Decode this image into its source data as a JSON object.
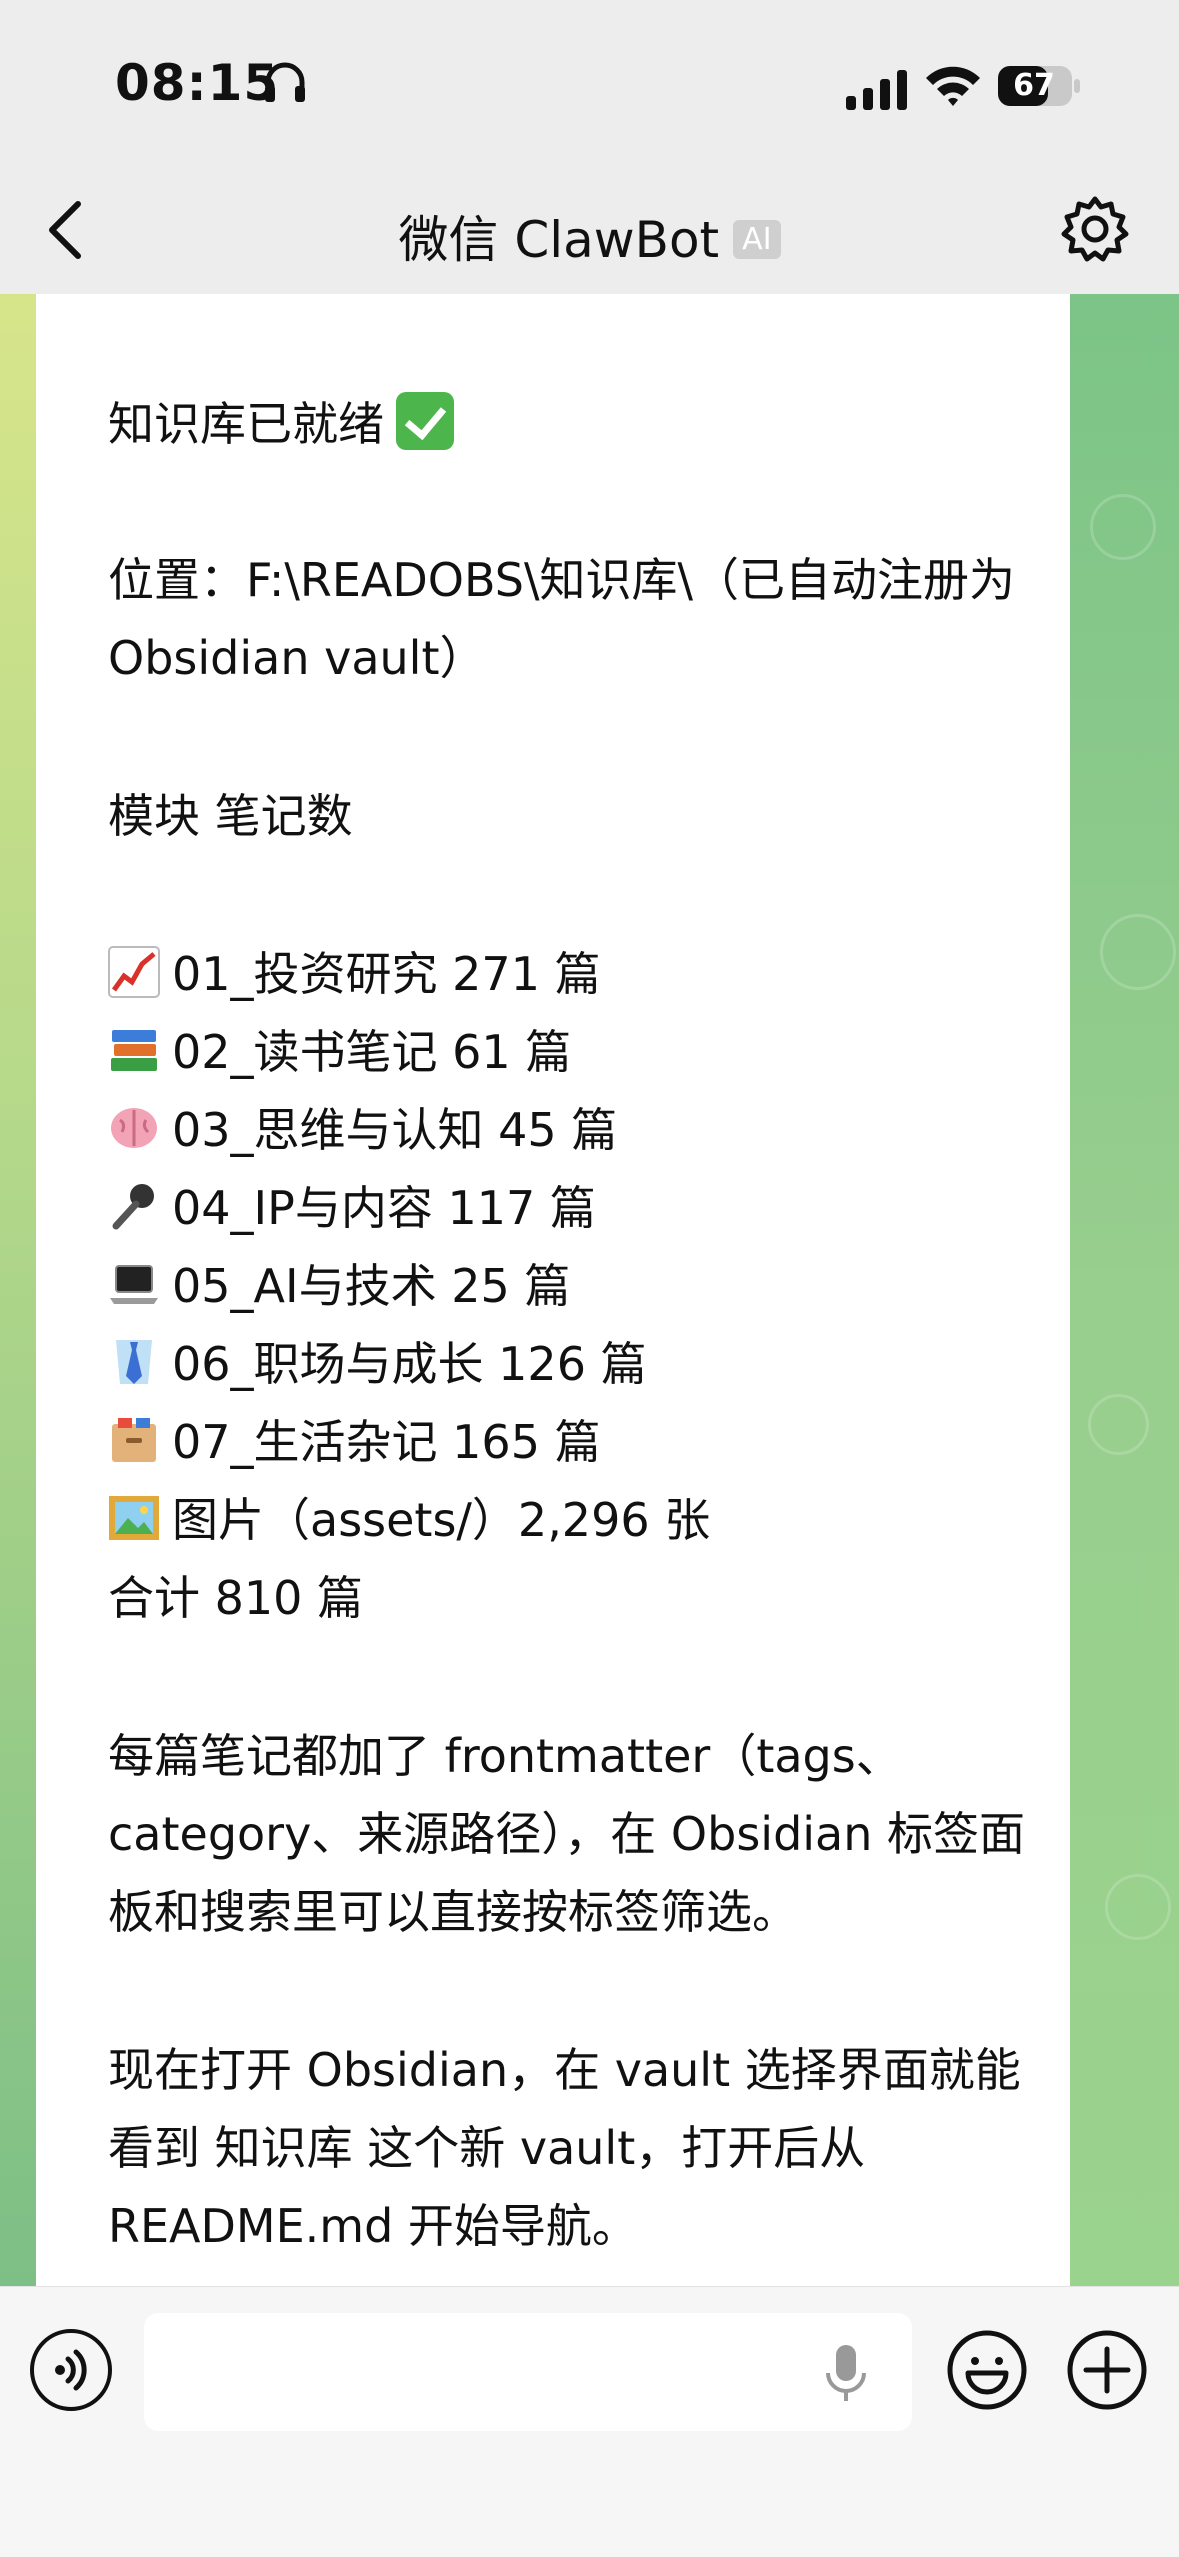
{
  "status_bar": {
    "time": "08:15",
    "battery": "67",
    "icons": [
      "headphone-icon",
      "signal-icon",
      "wifi-icon",
      "battery-icon"
    ]
  },
  "nav": {
    "title": "微信 ClawBot",
    "badge": "AI",
    "icons": [
      "back-icon",
      "gear-icon"
    ]
  },
  "message": {
    "status_line": "知识库已就绪",
    "location_line1": "位置：F:\\READOBS\\知识库\\（已自动注册为",
    "location_line2": "Obsidian vault）",
    "table_header": "模块  笔记数",
    "modules": [
      {
        "emoji": "chart-increasing-icon",
        "text": "01_投资研究  271 篇"
      },
      {
        "emoji": "books-icon",
        "text": "02_读书笔记  61 篇"
      },
      {
        "emoji": "brain-icon",
        "text": "03_思维与认知  45 篇"
      },
      {
        "emoji": "microphone-icon",
        "text": "04_IP与内容  117 篇"
      },
      {
        "emoji": "laptop-icon",
        "text": "05_AI与技术  25 篇"
      },
      {
        "emoji": "necktie-icon",
        "text": "06_职场与成长  126 篇"
      },
      {
        "emoji": "file-cabinet-icon",
        "text": "07_生活杂记  165 篇"
      },
      {
        "emoji": "framed-picture-icon",
        "text": "图片（assets/）2,296 张"
      }
    ],
    "total": "合计  810 篇",
    "para1_line1": "每篇笔记都加了 frontmatter（tags、",
    "para1_line2": "category、来源路径），在 Obsidian 标签面",
    "para1_line3": "板和搜索里可以直接按标签筛选。",
    "para2_line1": "现在打开 Obsidian，在 vault 选择界面就能",
    "para2_line2": "看到 知识库 这个新 vault，打开后从",
    "para2_line3": "README.md 开始导航。"
  },
  "input_bar": {
    "placeholder": "",
    "icons": [
      "voice-mode-icon",
      "microphone-icon",
      "emoji-icon",
      "plus-icon"
    ]
  },
  "colors": {
    "accent_green": "#4cb54c",
    "bubble": "#ffffff",
    "nav_bg": "#ededed"
  }
}
